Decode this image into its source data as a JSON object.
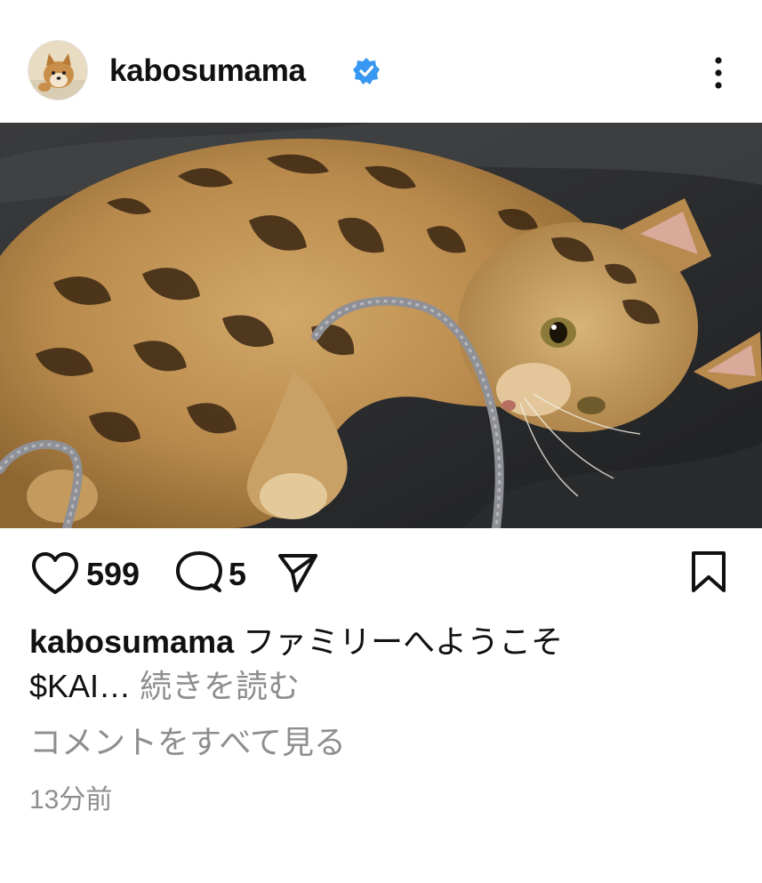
{
  "post": {
    "username": "kabosumama",
    "verified": true,
    "avatar_icon": "shiba-dog-avatar",
    "photo_description_icon": "bengal-cat-photo",
    "likes": "599",
    "comments": "5",
    "caption": {
      "username": "kabosumama",
      "text": "ファミリーへようこそ",
      "text2": "$KAI…",
      "more_label": "続きを読む"
    },
    "view_all_comments": "コメントをすべて見る",
    "timestamp": "13分前"
  },
  "colors": {
    "verified_blue": "#3897f0",
    "text_primary": "#111111",
    "text_secondary": "#8e8e8e",
    "background": "#ffffff"
  },
  "icons": {
    "like": "heart-icon",
    "comment": "comment-bubble-icon",
    "share": "paper-plane-icon",
    "save": "bookmark-icon",
    "menu": "more-vertical-icon"
  }
}
